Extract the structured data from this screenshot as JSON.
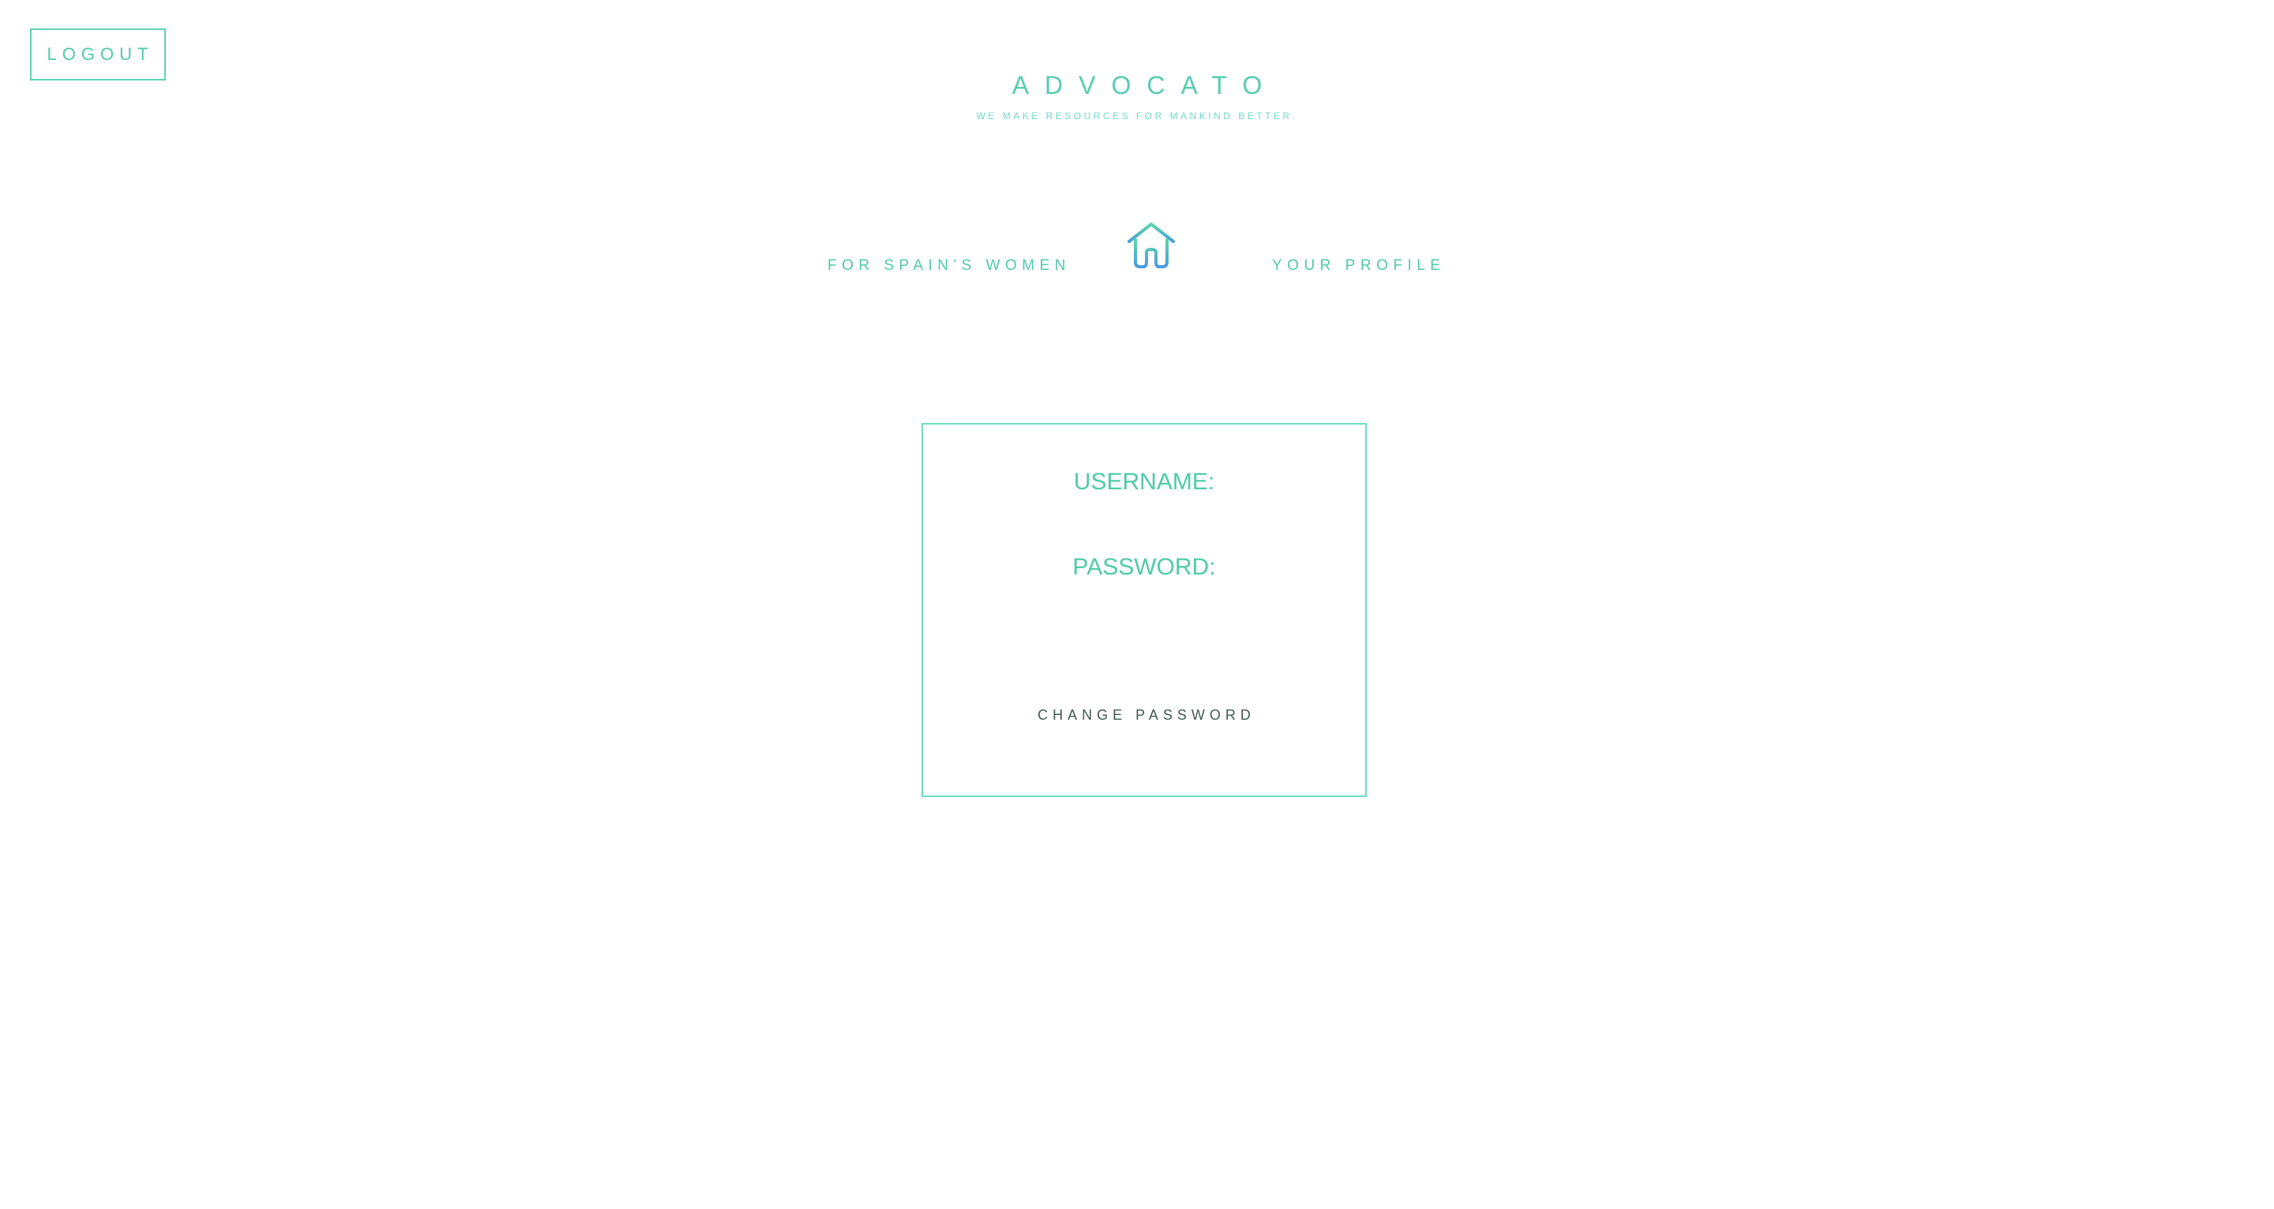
{
  "header": {
    "logout_label": "LOGOUT",
    "brand_name": "ADVOCATO",
    "tagline": "WE MAKE RESOURCES FOR MANKIND BETTER."
  },
  "nav": {
    "women_link": "FOR SPAIN'S WOMEN",
    "home_icon": "home-icon",
    "profile_link": "YOUR PROFILE"
  },
  "profile_card": {
    "username_label": "USERNAME:",
    "password_label": "PASSWORD:",
    "change_password_label": "CHANGE PASSWORD"
  },
  "colors": {
    "accent": "#4ecba9",
    "border": "#6fdcc2",
    "icon_gradient_top": "#5ad6a8",
    "icon_gradient_bottom": "#4a9de0",
    "button_text": "#3f5a52"
  }
}
